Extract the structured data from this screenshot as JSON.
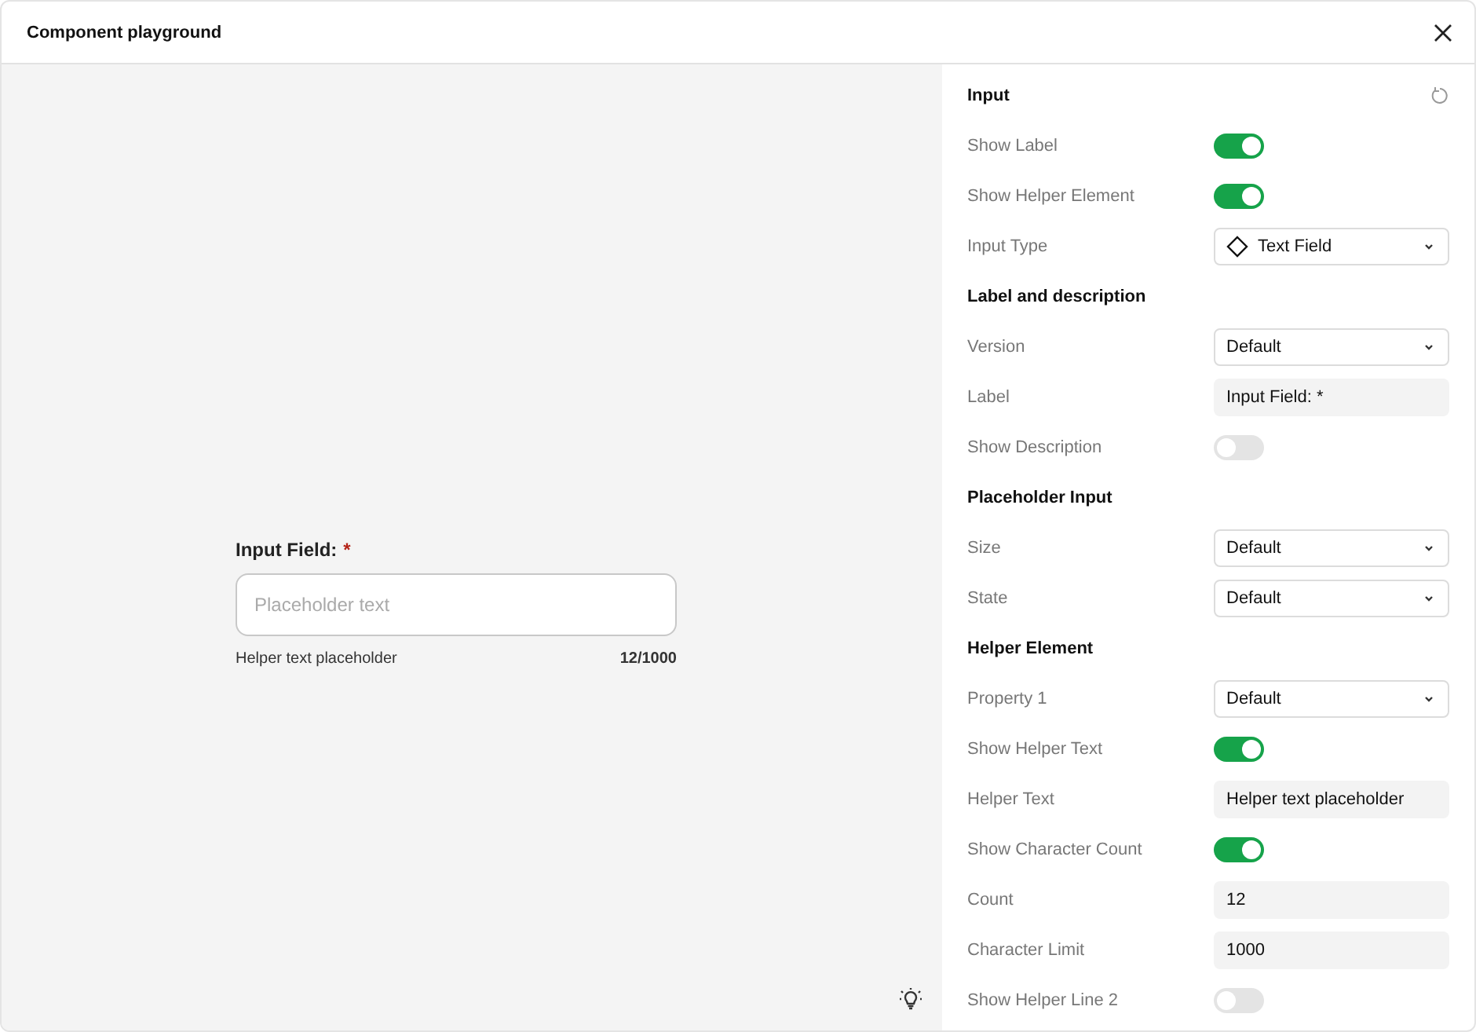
{
  "window": {
    "title": "Component playground"
  },
  "preview": {
    "label": "Input Field:",
    "required_mark": "*",
    "placeholder": "Placeholder text",
    "helper_text": "Helper text placeholder",
    "count": "12/1000"
  },
  "sections": [
    {
      "title": "Input",
      "rows": [
        {
          "kind": "toggle",
          "label": "Show Label",
          "on": true
        },
        {
          "kind": "toggle",
          "label": "Show Helper Element",
          "on": true
        },
        {
          "kind": "select",
          "label": "Input Type",
          "value": "Text Field",
          "has_icon": true
        }
      ]
    },
    {
      "title": "Label and description",
      "rows": [
        {
          "kind": "select",
          "label": "Version",
          "value": "Default"
        },
        {
          "kind": "text",
          "label": "Label",
          "value": "Input Field: *"
        },
        {
          "kind": "toggle",
          "label": "Show Description",
          "on": false
        }
      ]
    },
    {
      "title": "Placeholder Input",
      "rows": [
        {
          "kind": "select",
          "label": "Size",
          "value": "Default"
        },
        {
          "kind": "select",
          "label": "State",
          "value": "Default"
        }
      ]
    },
    {
      "title": "Helper Element",
      "rows": [
        {
          "kind": "select",
          "label": "Property 1",
          "value": "Default"
        },
        {
          "kind": "toggle",
          "label": "Show Helper Text",
          "on": true
        },
        {
          "kind": "text",
          "label": "Helper Text",
          "value": "Helper text placeholder"
        },
        {
          "kind": "toggle",
          "label": "Show Character Count",
          "on": true
        },
        {
          "kind": "text",
          "label": "Count",
          "value": "12"
        },
        {
          "kind": "text",
          "label": "Character Limit",
          "value": "1000"
        },
        {
          "kind": "toggle",
          "label": "Show Helper Line 2",
          "on": false
        }
      ]
    }
  ]
}
